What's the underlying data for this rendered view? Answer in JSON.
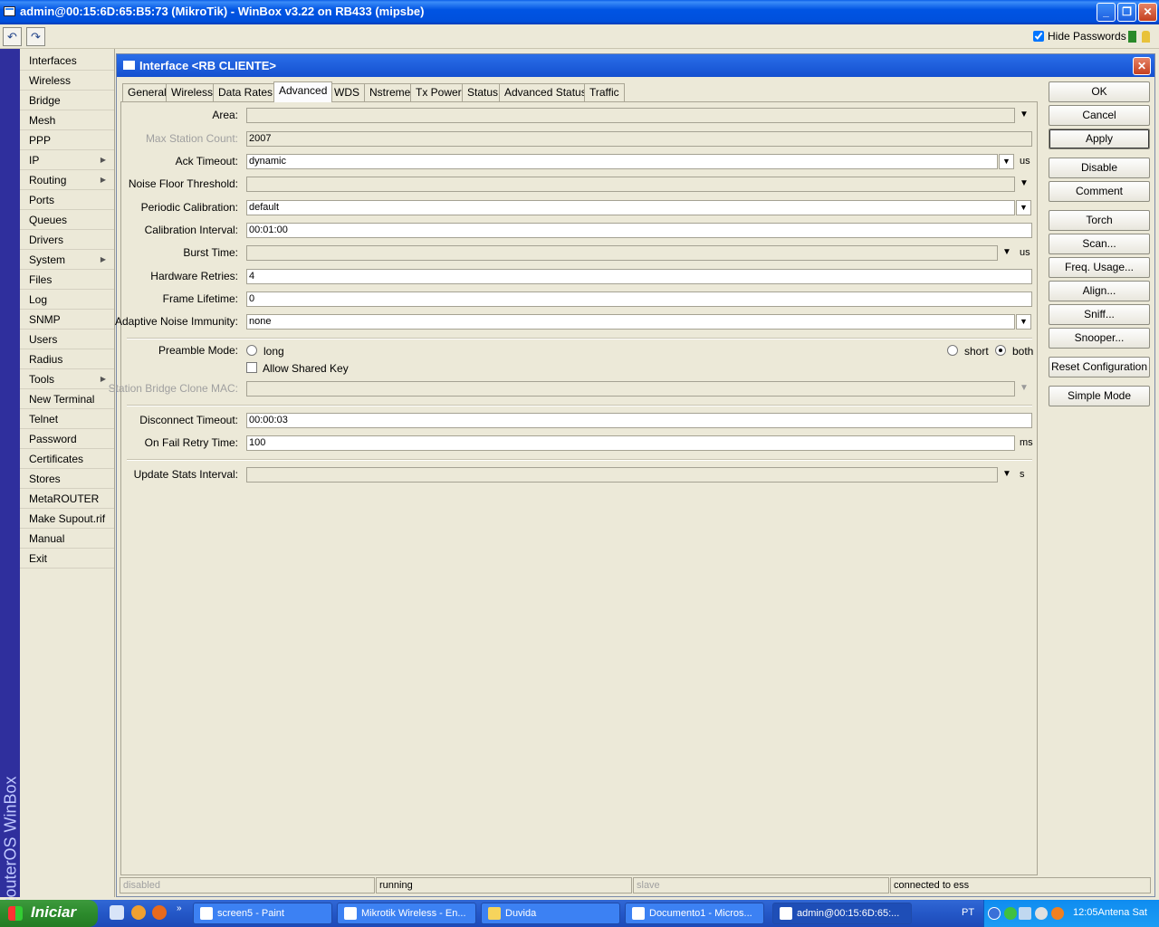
{
  "titlebar": {
    "title": "admin@00:15:6D:65:B5:73 (MikroTik) - WinBox v3.22 on RB433 (mipsbe)"
  },
  "toolbar": {
    "hide_passwords_label": "Hide Passwords",
    "hide_passwords_checked": true
  },
  "side": {
    "brand": "RouterOS WinBox"
  },
  "menu": [
    "Interfaces",
    "Wireless",
    "Bridge",
    "Mesh",
    "PPP",
    "IP",
    "Routing",
    "Ports",
    "Queues",
    "Drivers",
    "System",
    "Files",
    "Log",
    "SNMP",
    "Users",
    "Radius",
    "Tools",
    "New Terminal",
    "Telnet",
    "Password",
    "Certificates",
    "Stores",
    "MetaROUTER",
    "Make Supout.rif",
    "Manual",
    "Exit"
  ],
  "window": {
    "title": "Interface <RB CLIENTE>",
    "tabs": [
      "General",
      "Wireless",
      "Data Rates",
      "Advanced",
      "WDS",
      "Nstreme",
      "Tx Power",
      "Status",
      "Advanced Status",
      "Traffic"
    ],
    "active_tab": "Advanced",
    "fields": {
      "area": {
        "label": "Area:",
        "value": ""
      },
      "max_station_count": {
        "label": "Max Station Count:",
        "value": "2007"
      },
      "ack_timeout": {
        "label": "Ack Timeout:",
        "value": "dynamic",
        "unit": "us"
      },
      "noise_floor_threshold": {
        "label": "Noise Floor Threshold:",
        "value": ""
      },
      "periodic_calibration": {
        "label": "Periodic Calibration:",
        "value": "default"
      },
      "calibration_interval": {
        "label": "Calibration Interval:",
        "value": "00:01:00"
      },
      "burst_time": {
        "label": "Burst Time:",
        "value": "",
        "unit": "us"
      },
      "hardware_retries": {
        "label": "Hardware Retries:",
        "value": "4"
      },
      "frame_lifetime": {
        "label": "Frame Lifetime:",
        "value": "0"
      },
      "adaptive_noise_immunity": {
        "label": "Adaptive Noise Immunity:",
        "value": "none"
      },
      "preamble_mode": {
        "label": "Preamble Mode:",
        "options": [
          "long",
          "short",
          "both"
        ],
        "selected": "both"
      },
      "allow_shared_key": {
        "label": "Allow Shared Key",
        "checked": false
      },
      "station_bridge_clone_mac": {
        "label": "Station Bridge Clone MAC:",
        "value": ""
      },
      "disconnect_timeout": {
        "label": "Disconnect Timeout:",
        "value": "00:00:03"
      },
      "on_fail_retry_time": {
        "label": "On Fail Retry Time:",
        "value": "100",
        "unit": "ms"
      },
      "update_stats_interval": {
        "label": "Update Stats Interval:",
        "value": "",
        "unit": "s"
      }
    },
    "buttons": [
      "OK",
      "Cancel",
      "Apply",
      "Disable",
      "Comment",
      "Torch",
      "Scan...",
      "Freq. Usage...",
      "Align...",
      "Sniff...",
      "Snooper...",
      "Reset Configuration",
      "Simple Mode"
    ],
    "status": [
      "disabled",
      "running",
      "slave",
      "connected to ess"
    ]
  },
  "taskbar": {
    "start_label": "Iniciar",
    "items": [
      "screen5 - Paint",
      "Mikrotik Wireless - En...",
      "Duvida",
      "Documento1 - Micros...",
      "admin@00:15:6D:65:..."
    ],
    "language": "PT",
    "clock": "12:05Antena Sat"
  },
  "colors": {
    "titlebar": "#0054e3",
    "menu_strip": "#2f2f9d",
    "taskbar": "#2457c7",
    "start": "#2c8b2c"
  }
}
